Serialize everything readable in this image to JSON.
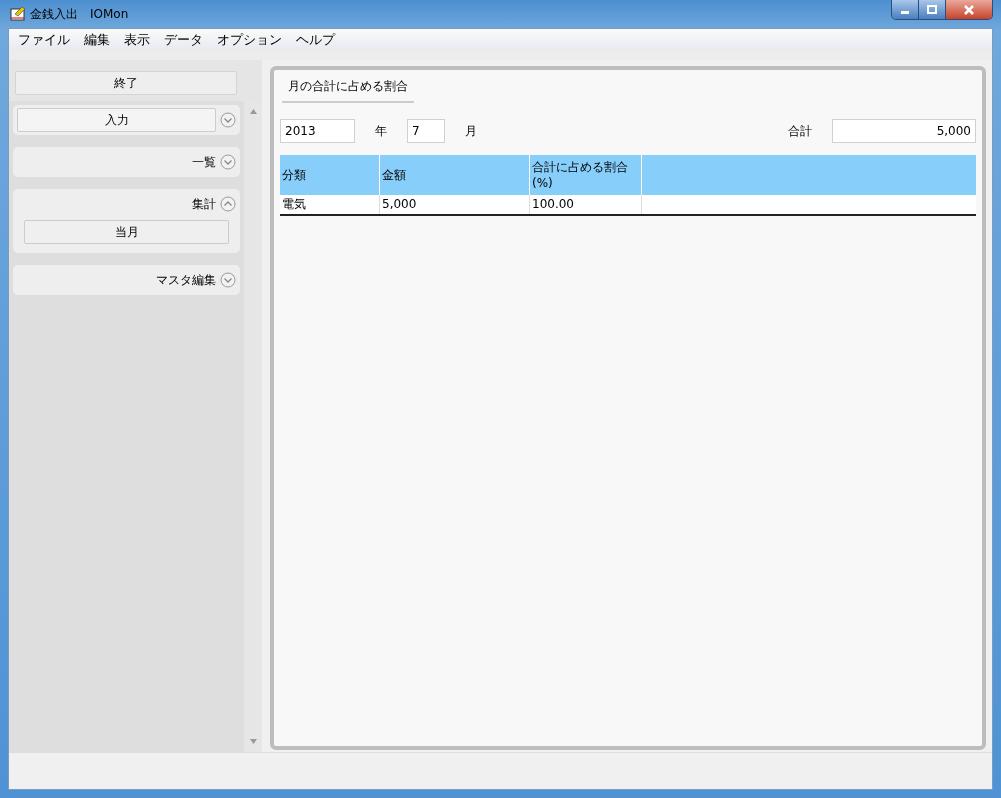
{
  "window": {
    "title": "金銭入出　IOMon"
  },
  "menu": [
    "ファイル",
    "編集",
    "表示",
    "データ",
    "オプション",
    "ヘルプ"
  ],
  "sidebar": {
    "exit_button": "終了",
    "sections": [
      {
        "kind": "button",
        "label": "入力",
        "expanded": false
      },
      {
        "kind": "header",
        "label": "一覧",
        "expanded": false
      },
      {
        "kind": "header",
        "label": "集計",
        "expanded": true,
        "items": [
          "当月"
        ]
      },
      {
        "kind": "header",
        "label": "マスタ編集",
        "expanded": false
      }
    ]
  },
  "panel": {
    "tab": "月の合計に占める割合",
    "year": "2013",
    "year_label": "年",
    "month": "7",
    "month_label": "月",
    "total_label": "合計",
    "total": "5,000",
    "table": {
      "columns": [
        "分類",
        "金額",
        "合計に占める割合(%)"
      ],
      "rows": [
        [
          "電気",
          "5,000",
          "100.00"
        ]
      ]
    }
  }
}
